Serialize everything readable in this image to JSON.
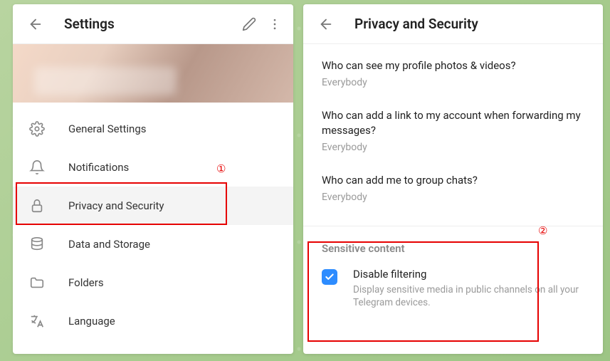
{
  "left": {
    "title": "Settings",
    "menu": [
      {
        "label": "General Settings"
      },
      {
        "label": "Notifications"
      },
      {
        "label": "Privacy and Security"
      },
      {
        "label": "Data and Storage"
      },
      {
        "label": "Folders"
      },
      {
        "label": "Language"
      }
    ]
  },
  "right": {
    "title": "Privacy and Security",
    "items": [
      {
        "q": "Who can see my profile photos & videos?",
        "v": "Everybody"
      },
      {
        "q": "Who can add a link to my account when forwarding my messages?",
        "v": "Everybody"
      },
      {
        "q": "Who can add me to group chats?",
        "v": "Everybody"
      }
    ],
    "section": "Sensitive content",
    "checkbox": {
      "title": "Disable filtering",
      "desc": "Display sensitive media in public channels on all your Telegram devices.",
      "checked": true
    }
  },
  "annotations": {
    "one": "①",
    "two": "②"
  }
}
